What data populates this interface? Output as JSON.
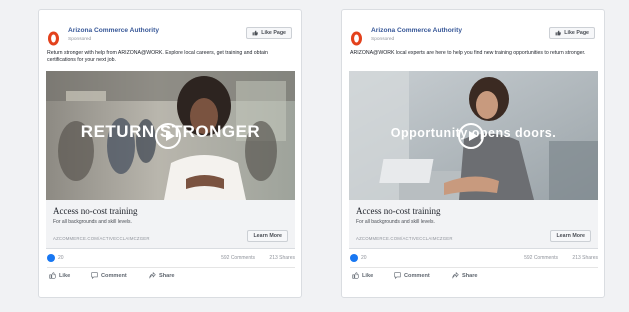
{
  "colors": {
    "brand": "#385898",
    "logo_red": "#e3411c",
    "reaction_blue": "#1877f2"
  },
  "ads": [
    {
      "page_name": "Arizona Commerce Authority",
      "sponsored": "Sponsored",
      "like_page": "Like Page",
      "body": "Return stronger with help from ARIZONA@WORK. Explore local careers, get training and obtain certifications for your next job.",
      "overlay_text": "RETURN STRONGER",
      "headline": "Access no-cost training",
      "description": "For all backgrounds and skill levels.",
      "link": "AZCOMMERCE.COM/ACTIVECCLAIMCZGER",
      "cta": "Learn More",
      "reactions": "20",
      "comments": "592 Comments",
      "shares": "213 Shares",
      "actions": {
        "like": "Like",
        "comment": "Comment",
        "share": "Share"
      }
    },
    {
      "page_name": "Arizona Commerce Authority",
      "sponsored": "Sponsored",
      "like_page": "Like Page",
      "body": "ARIZONA@WORK local experts are here to help you find new training opportunities to return stronger.",
      "overlay_text": "Opportunity opens doors.",
      "headline": "Access no-cost training",
      "description": "For all backgrounds and skill levels.",
      "link": "AZCOMMERCE.COM/ACTIVECCLAIMCZGER",
      "cta": "Learn More",
      "reactions": "20",
      "comments": "592 Comments",
      "shares": "213 Shares",
      "actions": {
        "like": "Like",
        "comment": "Comment",
        "share": "Share"
      }
    }
  ]
}
